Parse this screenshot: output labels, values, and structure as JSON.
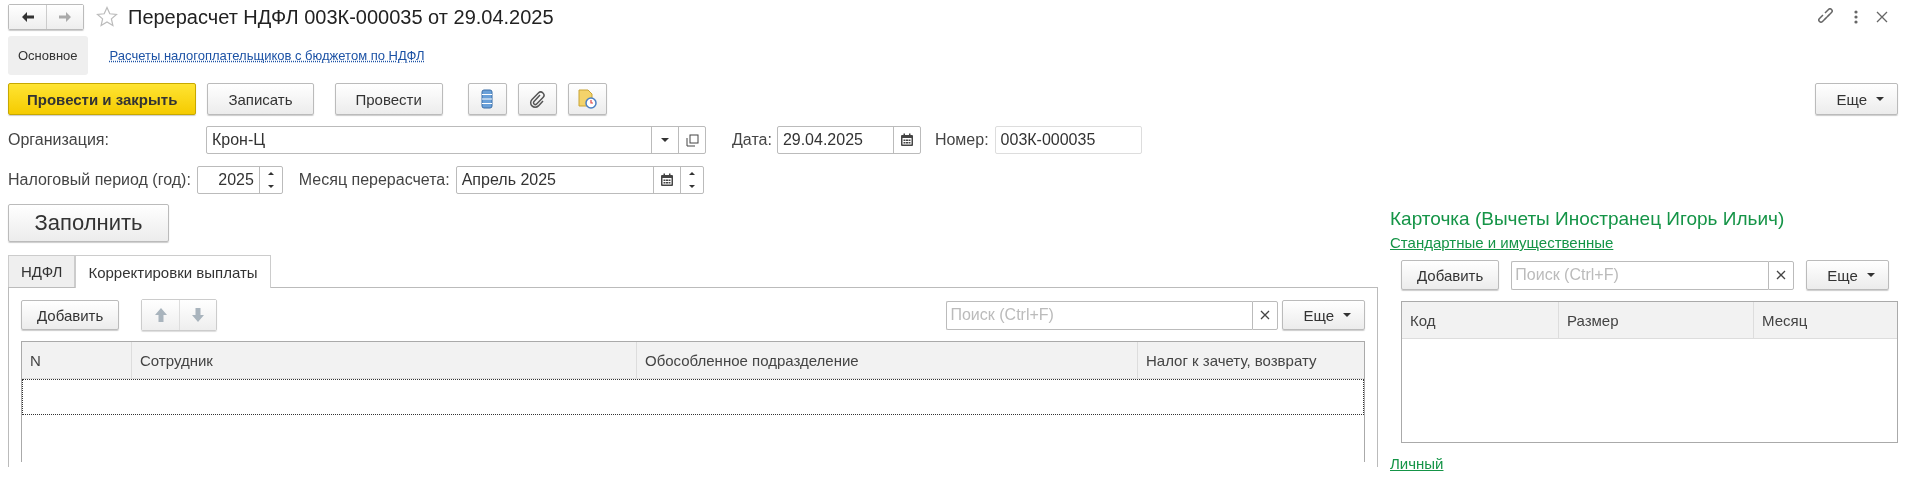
{
  "window": {
    "title": "Перерасчет НДФЛ 003К-000035 от 29.04.2025",
    "favorite": false
  },
  "nav": [
    {
      "label": "Основное",
      "selected": true
    },
    {
      "label": "Расчеты налогоплательщиков с бюджетом по НДФЛ",
      "selected": false
    }
  ],
  "toolbar": {
    "buttons": [
      {
        "label": "Провести и закрыть",
        "kind": "primary"
      },
      {
        "label": "Записать",
        "kind": "normal"
      },
      {
        "label": "Провести",
        "kind": "normal"
      }
    ],
    "more": "Еще"
  },
  "organization": {
    "label": "Организация:",
    "value": "Крон-Ц"
  },
  "date": {
    "label": "Дата:",
    "value": "29.04.2025"
  },
  "number": {
    "label": "Номер:",
    "value": "003К-000035"
  },
  "tax_period": {
    "label": "Налоговый период (год):",
    "value": "2025"
  },
  "recalc_month": {
    "label": "Месяц перерасчета:",
    "value": "Апрель 2025"
  },
  "fill_button": "Заполнить",
  "tabs": [
    {
      "label": "НДФЛ",
      "selected": false
    },
    {
      "label": "Корректировки выплаты",
      "selected": true
    }
  ],
  "corrections": {
    "add": "Добавить",
    "search": {
      "placeholder": "Поиск (Ctrl+F)"
    },
    "more": "Еще",
    "columns": [
      "N",
      "Сотрудник",
      "Обособленное подразделение",
      "Налог к зачету, возврату"
    ]
  },
  "card": {
    "title": "Карточка (Вычеты Иностранец Игорь Ильич)",
    "link": "Стандартные и имущественные",
    "add": "Добавить",
    "search": {
      "placeholder": "Поиск (Ctrl+F)"
    },
    "more": "Еще",
    "columns": [
      "Код",
      "Размер",
      "Месяц"
    ],
    "personal_link": "Личный"
  }
}
